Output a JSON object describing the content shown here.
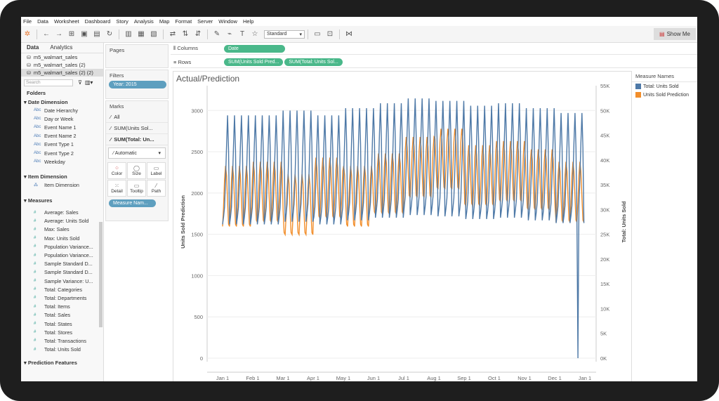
{
  "menu": [
    "File",
    "Data",
    "Worksheet",
    "Dashboard",
    "Story",
    "Analysis",
    "Map",
    "Format",
    "Server",
    "Window",
    "Help"
  ],
  "toolbar": {
    "standard": "Standard",
    "show_me": "Show Me"
  },
  "data_pane": {
    "tabs": [
      "Data",
      "Analytics"
    ],
    "sources": [
      "m5_walmart_sales",
      "m5_walmart_sales (2)",
      "m5_walmart_sales (2) (2)"
    ],
    "search_placeholder": "Search",
    "folders_label": "Folders",
    "date_dimension": {
      "label": "Date Dimension",
      "fields": [
        "Date Hierarchy",
        "Day or Week",
        "Event Name 1",
        "Event Name 2",
        "Event Type 1",
        "Event Type 2",
        "Weekday"
      ]
    },
    "item_dimension": {
      "label": "Item Dimension",
      "fields": [
        "Item Dimension"
      ]
    },
    "measures": {
      "label": "Measures",
      "fields": [
        "Average: Sales",
        "Average: Units Sold",
        "Max: Sales",
        "Max: Units Sold",
        "Population Variance...",
        "Population Variance...",
        "Sample Standard D...",
        "Sample Standard D...",
        "Sample Variance: U...",
        "Total: Categories",
        "Total: Departments",
        "Total: Items",
        "Total: Sales",
        "Total: States",
        "Total: Stores",
        "Total: Transactions",
        "Total: Units Sold"
      ]
    },
    "prediction_features": "Prediction Features"
  },
  "pages_label": "Pages",
  "filters": {
    "label": "Filters",
    "pill": "Year: 2015"
  },
  "marks": {
    "label": "Marks",
    "rows": [
      "All",
      "SUM(Units Sol...",
      "SUM(Total: Un..."
    ],
    "type": "Automatic",
    "buttons": [
      "Color",
      "Size",
      "Label",
      "Detail",
      "Tooltip",
      "Path"
    ],
    "pill": "Measure Nam..."
  },
  "shelves": {
    "columns_label": "Columns",
    "columns_pill": "Date",
    "rows_label": "Rows",
    "rows_pills": [
      "SUM(Units Sold Pred...",
      "SUM(Total: Units Sol..."
    ]
  },
  "legend": {
    "title": "Measure Names",
    "items": [
      "Total: Units Sold",
      "Units Sold Prediction"
    ],
    "colors": [
      "#4e79a7",
      "#f28e2b"
    ]
  },
  "chart_data": {
    "type": "line",
    "title": "Actual/Prediction",
    "xlabel": "",
    "x_ticks": [
      "Jan 1",
      "Feb 1",
      "Mar 1",
      "Apr 1",
      "May 1",
      "Jun 1",
      "Jul 1",
      "Aug 1",
      "Sep 1",
      "Oct 1",
      "Nov 1",
      "Dec 1",
      "Jan 1"
    ],
    "y_left": {
      "label": "Units Sold Prediction",
      "ticks": [
        "0",
        "500",
        "1000",
        "1500",
        "2000",
        "2500",
        "3000"
      ],
      "range": [
        0,
        3300
      ]
    },
    "y_right": {
      "label": "Total: Units Sold",
      "ticks": [
        "0K",
        "5K",
        "10K",
        "15K",
        "20K",
        "25K",
        "30K",
        "35K",
        "40K",
        "45K",
        "50K",
        "55K"
      ],
      "range": [
        0,
        55000
      ]
    },
    "series": [
      {
        "name": "Total: Units Sold",
        "color": "#4e79a7",
        "axis": "right",
        "weekly_pattern": [
          27000,
          28500,
          30500,
          36000,
          43000,
          49000,
          42000
        ],
        "monthly_level": [
          1.0,
          1.0,
          1.02,
          1.0,
          1.03,
          1.05,
          1.07,
          1.06,
          1.04,
          1.05,
          1.03,
          1.01
        ],
        "christmas_value": 0
      },
      {
        "name": "Units Sold Prediction",
        "color": "#f28e2b",
        "axis": "left",
        "monthly_avg": [
          1950,
          2000,
          1850,
          2050,
          1950,
          2100,
          2300,
          2400,
          2200,
          2250,
          2150,
          2000
        ],
        "amplitude": 380
      }
    ]
  }
}
